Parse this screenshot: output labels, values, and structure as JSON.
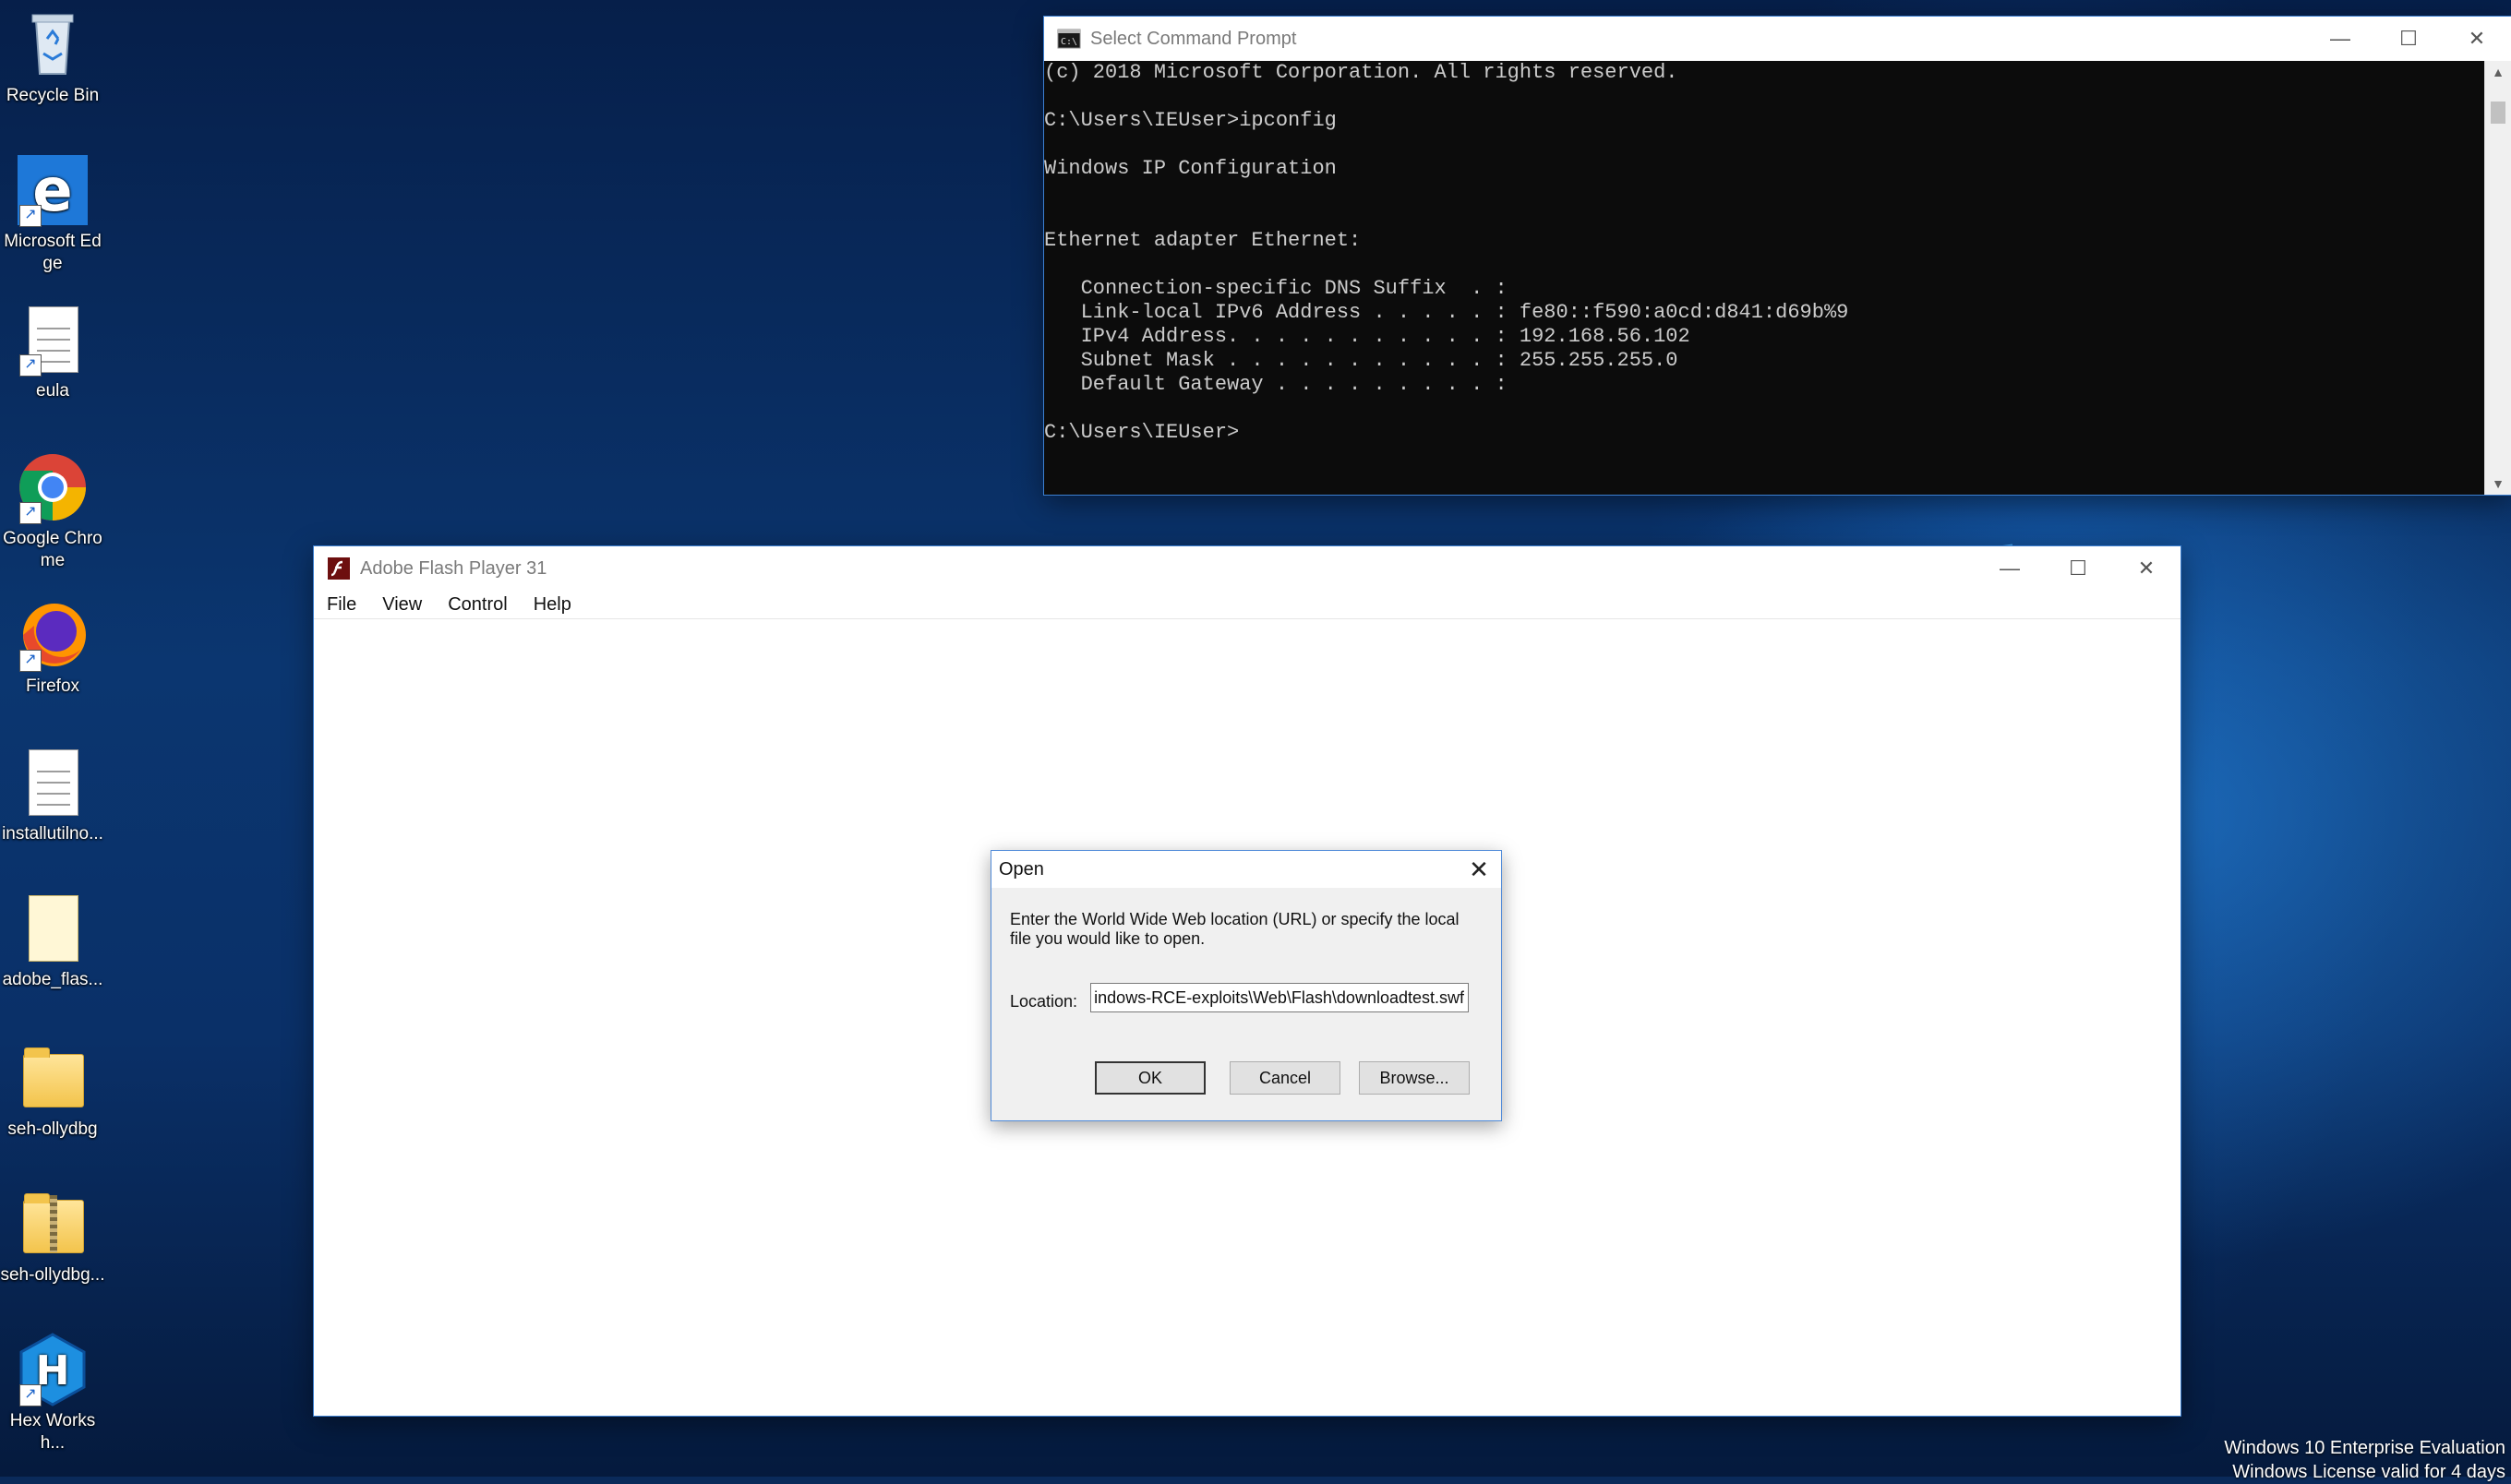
{
  "desktop": {
    "icons": [
      {
        "label": "Recycle Bin",
        "icon": "recycle-bin-icon"
      },
      {
        "label": "Microsoft Edge",
        "icon": "edge-icon"
      },
      {
        "label": "eula",
        "icon": "document-icon"
      },
      {
        "label": "Google Chrome",
        "icon": "chrome-icon"
      },
      {
        "label": "Firefox",
        "icon": "firefox-icon"
      },
      {
        "label": "installutilno...",
        "icon": "document-icon"
      },
      {
        "label": "adobe_flas...",
        "icon": "document-icon"
      },
      {
        "label": "seh-ollydbg",
        "icon": "folder-icon"
      },
      {
        "label": "seh-ollydbg...",
        "icon": "zip-folder-icon"
      },
      {
        "label": "Hex Worksh...",
        "icon": "hex-workshop-icon"
      }
    ],
    "watermark": {
      "line1": "Windows 10 Enterprise Evaluation",
      "line2": "Windows License valid for 4 days"
    }
  },
  "cmd_window": {
    "title": "Select Command Prompt",
    "lines": [
      "(c) 2018 Microsoft Corporation. All rights reserved.",
      "",
      "C:\\Users\\IEUser>ipconfig",
      "",
      "Windows IP Configuration",
      "",
      "",
      "Ethernet adapter Ethernet:",
      "",
      "   Connection-specific DNS Suffix  . :",
      "   Link-local IPv6 Address . . . . . : fe80::f590:a0cd:d841:d69b%9",
      "   IPv4 Address. . . . . . . . . . . : 192.168.56.102",
      "   Subnet Mask . . . . . . . . . . . : 255.255.255.0",
      "   Default Gateway . . . . . . . . . :",
      "",
      "C:\\Users\\IEUser>"
    ]
  },
  "flash_window": {
    "title": "Adobe Flash Player 31",
    "menu": [
      "File",
      "View",
      "Control",
      "Help"
    ]
  },
  "open_dialog": {
    "title": "Open",
    "prompt": "Enter the World Wide Web location (URL) or specify the local file you would like to open.",
    "location_label": "Location:",
    "location_value": "Windows-RCE-exploits\\Web\\Flash\\downloadtest.swf",
    "ok_label": "OK",
    "cancel_label": "Cancel",
    "browse_label": "Browse..."
  },
  "colors": {
    "accent": "#3c7fd0",
    "console_bg": "#0c0c0c",
    "console_fg": "#cccccc"
  }
}
